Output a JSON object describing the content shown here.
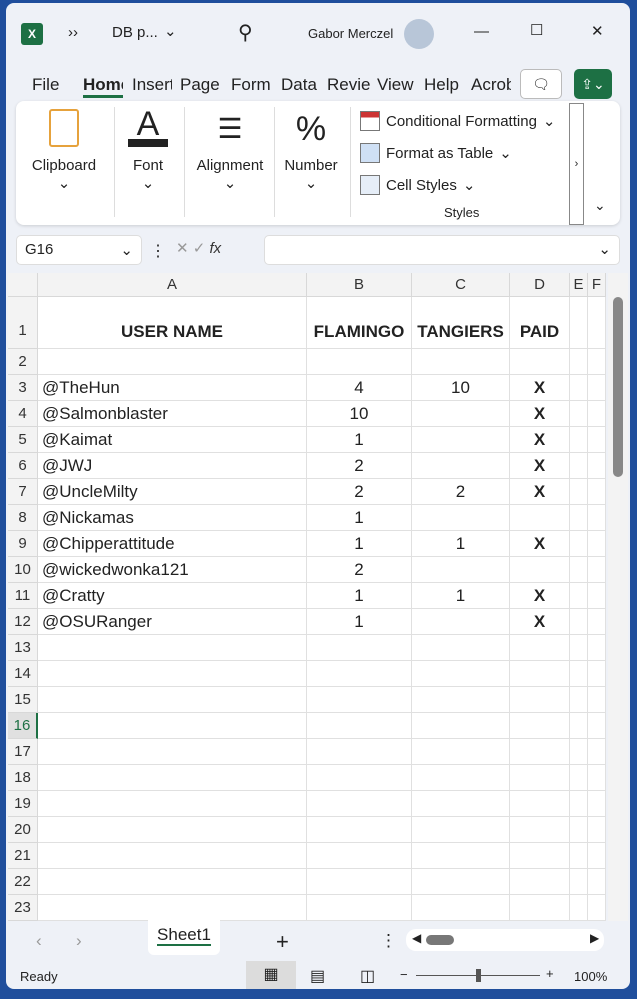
{
  "titlebar": {
    "app_icon": "excel-icon",
    "more": "››",
    "doc_name": "DB p...",
    "user": "Gabor Merczel",
    "minimize": "—",
    "maximize": "☐",
    "close": "✕"
  },
  "ribbon_tabs": [
    "File",
    "Home",
    "Insert",
    "Page",
    "Form",
    "Data",
    "Revie",
    "View",
    "Help",
    "Acrob"
  ],
  "ribbon_tab_active": "Home",
  "ribbon": {
    "clipboard": "Clipboard",
    "font": "Font",
    "alignment": "Alignment",
    "number": "Number",
    "conditional": "Conditional Formatting",
    "format_table": "Format as Table",
    "cell_styles": "Cell Styles",
    "styles": "Styles"
  },
  "formula_bar": {
    "name_box": "G16",
    "fx": "fx",
    "value": ""
  },
  "columns": [
    "A",
    "B",
    "C",
    "D",
    "E",
    "F"
  ],
  "rows": [
    [
      "USER NAME",
      "FLAMINGO",
      "TANGIERS",
      "PAID"
    ],
    [
      "",
      "",
      "",
      ""
    ],
    [
      "@TheHun",
      "4",
      "10",
      "X"
    ],
    [
      "@Salmonblaster",
      "10",
      "",
      "X"
    ],
    [
      "@Kaimat",
      "1",
      "",
      "X"
    ],
    [
      "@JWJ",
      "2",
      "",
      "X"
    ],
    [
      "@UncleMilty",
      "2",
      "2",
      "X"
    ],
    [
      "@Nickamas",
      "1",
      "",
      ""
    ],
    [
      "@Chipperattitude",
      "1",
      "1",
      "X"
    ],
    [
      "@wickedwonka121",
      "2",
      "",
      ""
    ],
    [
      "@Cratty",
      "1",
      "1",
      "X"
    ],
    [
      "@OSURanger",
      "1",
      "",
      "X"
    ]
  ],
  "row_count": 23,
  "selected_cell": "G16",
  "sheet_tab": "Sheet1",
  "add_sheet": "+",
  "status": {
    "ready": "Ready",
    "zoom": "100%",
    "zoom_slider": 0.5
  },
  "accent": "#1d7044"
}
